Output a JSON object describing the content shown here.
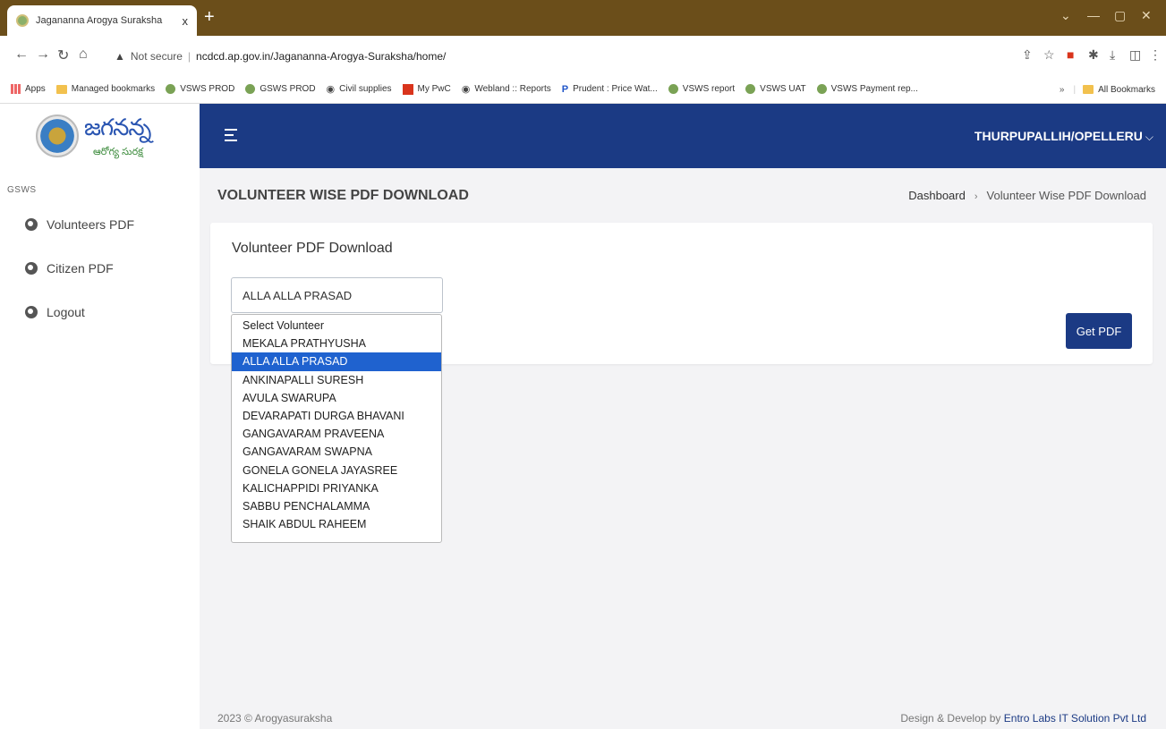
{
  "browser": {
    "tab_title": "Jagananna Arogya Suraksha",
    "tab_close": "x",
    "new_tab": "+",
    "not_secure": "Not secure",
    "url": "ncdcd.ap.gov.in/Jagananna-Arogya-Suraksha/home/",
    "bookmarks": [
      {
        "label": "Apps",
        "icon": "apps-grid-icon"
      },
      {
        "label": "Managed bookmarks",
        "icon": "folder-icon"
      },
      {
        "label": "VSWS PROD",
        "icon": "site-icon"
      },
      {
        "label": "GSWS PROD",
        "icon": "site-icon"
      },
      {
        "label": "Civil supplies",
        "icon": "globe-icon"
      },
      {
        "label": "My PwC",
        "icon": "pwc-icon"
      },
      {
        "label": "Webland :: Reports",
        "icon": "globe-icon"
      },
      {
        "label": "Prudent : Price Wat...",
        "icon": "prudent-icon"
      },
      {
        "label": "VSWS report",
        "icon": "site-icon"
      },
      {
        "label": "VSWS UAT",
        "icon": "site-icon"
      },
      {
        "label": "VSWS Payment rep...",
        "icon": "site-icon"
      }
    ],
    "bookmarks_more": "»",
    "all_bookmarks": "All Bookmarks"
  },
  "sidebar": {
    "logo_text": "జగనన్న",
    "logo_sub": "ఆరోగ్య సురక్ష",
    "section_label": "GSWS",
    "items": [
      {
        "label": "Volunteers PDF"
      },
      {
        "label": "Citizen PDF"
      },
      {
        "label": "Logout"
      }
    ]
  },
  "header": {
    "user": "THURPUPALLIH/OPELLERU",
    "user_chevron": "⌵"
  },
  "page": {
    "title": "VOLUNTEER WISE PDF DOWNLOAD",
    "breadcrumb": {
      "home": "Dashboard",
      "sep": "›",
      "current": "Volunteer Wise PDF Download"
    }
  },
  "card": {
    "title": "Volunteer PDF Download",
    "selected": "ALLA ALLA PRASAD",
    "button": "Get PDF",
    "options": [
      "Select Volunteer",
      "MEKALA PRATHYUSHA",
      "ALLA ALLA PRASAD",
      "ANKINAPALLI SURESH",
      "AVULA SWARUPA",
      "DEVARAPATI DURGA BHAVANI",
      "GANGAVARAM PRAVEENA",
      "GANGAVARAM SWAPNA",
      "GONELA GONELA JAYASREE",
      "KALICHAPPIDI PRIYANKA",
      "SABBU PENCHALAMMA",
      "SHAIK ABDUL RAHEEM"
    ],
    "selected_index": 2
  },
  "footer": {
    "left": "2023 © Arogyasuraksha",
    "right_prefix": "Design & Develop by ",
    "right_company": "Entro Labs IT Solution Pvt Ltd"
  }
}
